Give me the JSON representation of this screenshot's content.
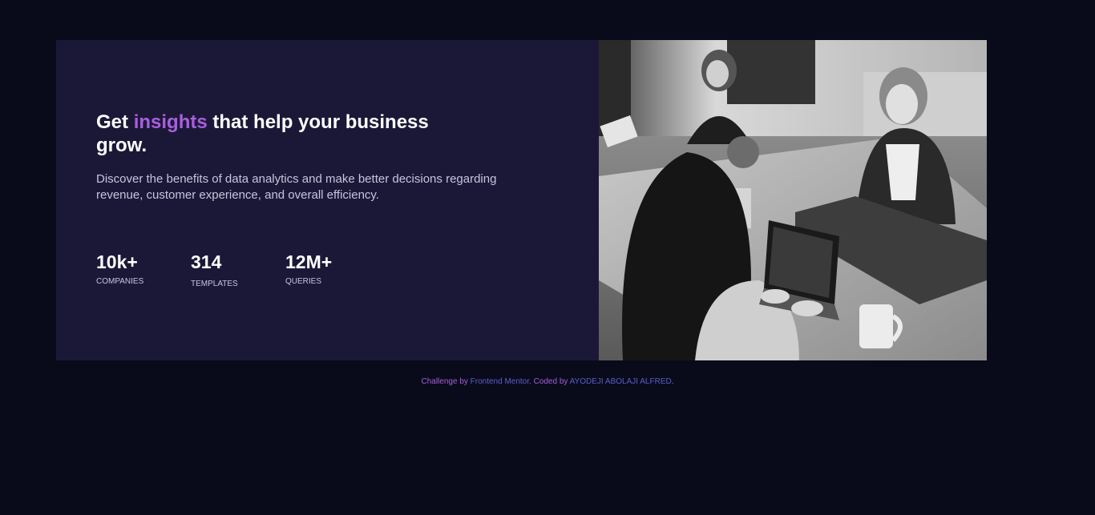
{
  "hero": {
    "headline_before": "Get",
    "headline_accent": "insights",
    "headline_after": "that help your business grow.",
    "description": "Discover the benefits of data analytics and make better decisions regarding revenue, customer experience, and overall efficiency."
  },
  "stats": [
    {
      "value": "10k+",
      "label": "COMPANIES"
    },
    {
      "value": "314",
      "label": "TEMPLATES"
    },
    {
      "value": "12M+",
      "label": "QUERIES"
    }
  ],
  "footer": {
    "challenge_by": "Challenge by",
    "challenge_link": "Frontend Mentor",
    "coded_by": ". Coded by",
    "author_link": "AYODEJI ABOLAJI ALFRED",
    "end": "."
  },
  "colors": {
    "page_background": "#090b1b",
    "card_background": "#1b1837",
    "accent": "#a95ede",
    "link": "#5b5fc7",
    "text_muted": "#c6c4dd"
  }
}
